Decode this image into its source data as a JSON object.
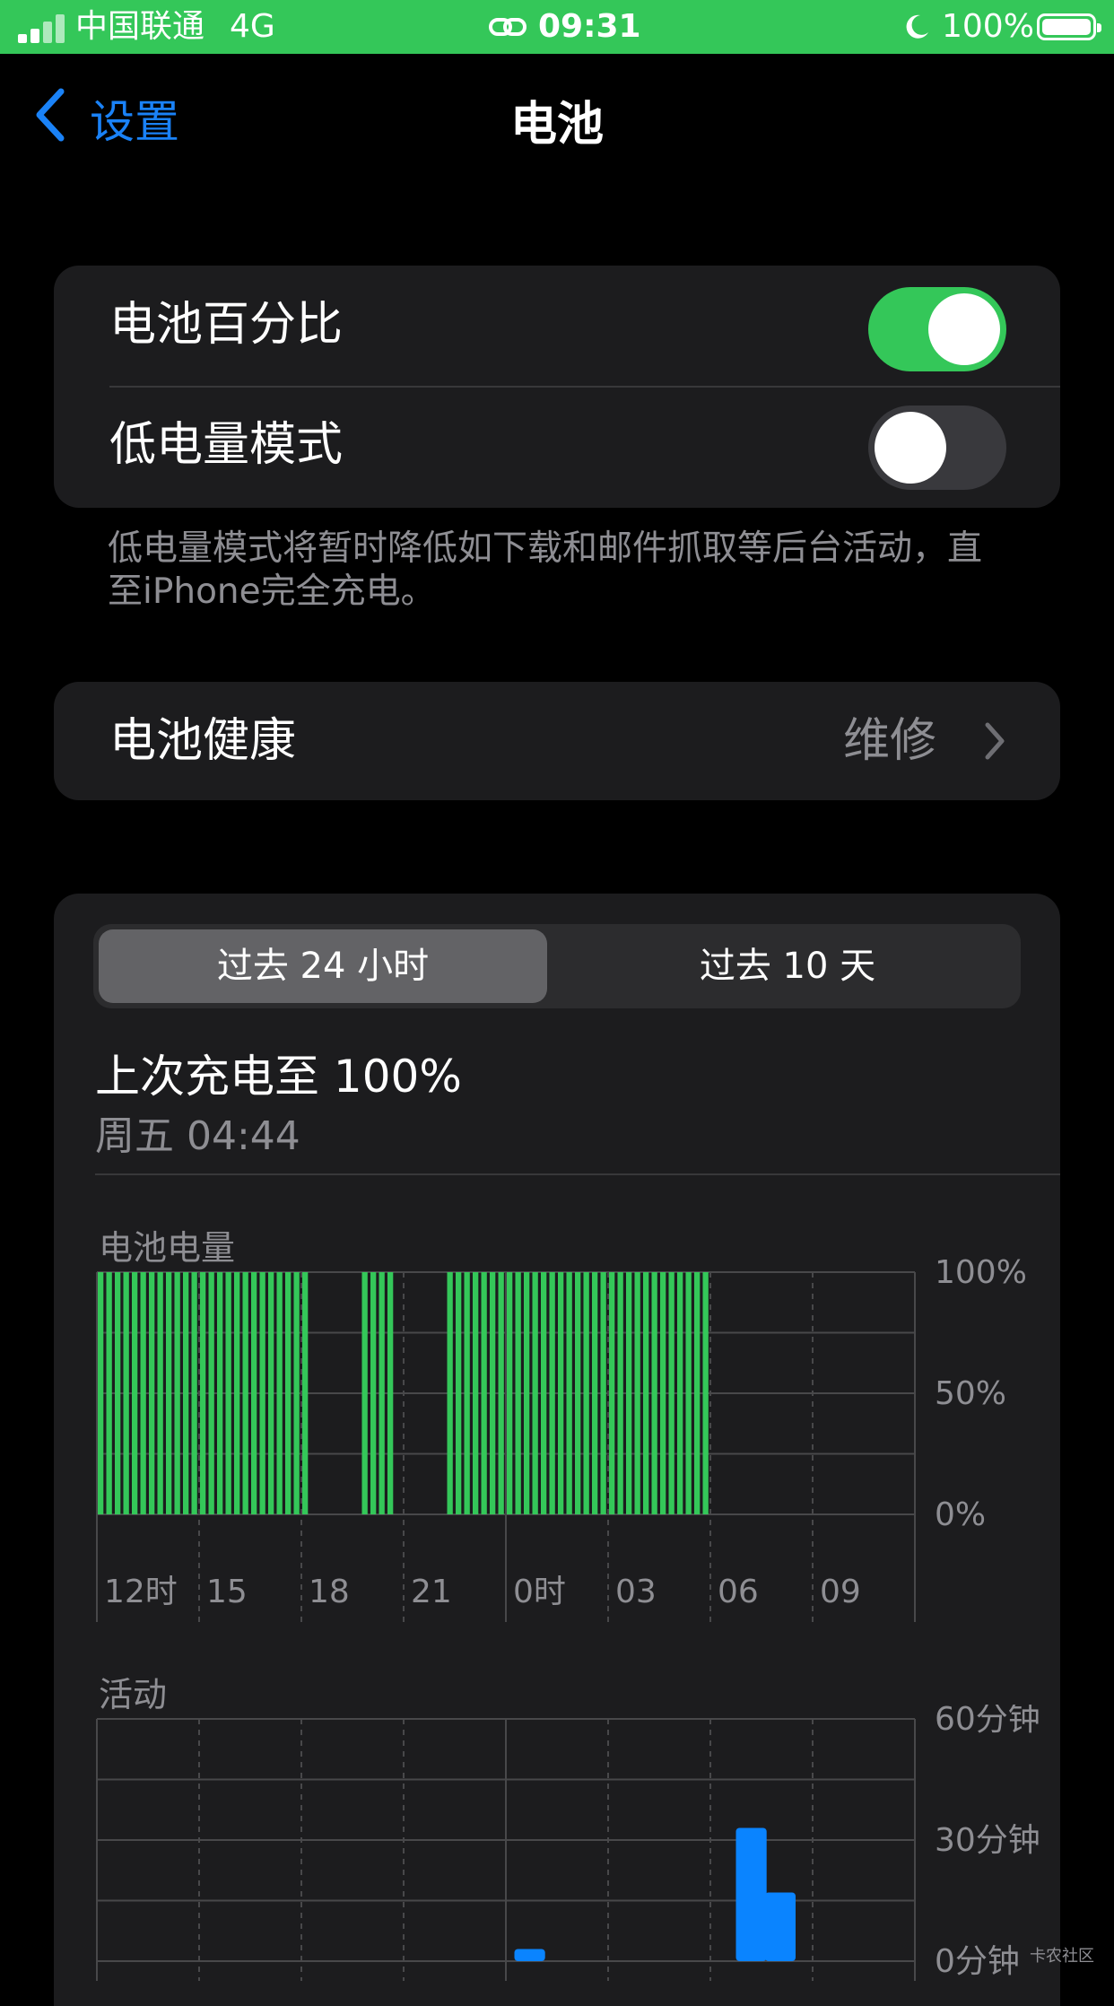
{
  "status_bar": {
    "carrier": "中国联通",
    "network": "4G",
    "time": "09:31",
    "battery_percent": "100%"
  },
  "nav": {
    "back_label": "设置",
    "title": "电池"
  },
  "settings": {
    "battery_percentage": {
      "label": "电池百分比",
      "on": true
    },
    "low_power_mode": {
      "label": "低电量模式",
      "on": false
    },
    "low_power_note": "低电量模式将暂时降低如下载和邮件抓取等后台活动，直至iPhone完全充电。",
    "battery_health": {
      "label": "电池健康",
      "value": "维修"
    }
  },
  "usage": {
    "tabs": [
      {
        "label": "过去 24 小时",
        "active": true
      },
      {
        "label": "过去 10 天",
        "active": false
      }
    ],
    "last_charge_title": "上次充电至 100%",
    "last_charge_time": "周五 04:44"
  },
  "colors": {
    "accent": "#1a82f7",
    "toggle_on": "#34c759",
    "battery_bar": "#34c759",
    "activity_bar": "#0a84ff",
    "card": "#1c1c1e"
  },
  "watermark": "卡农社区",
  "chart_data": [
    {
      "type": "bar",
      "title": "电池电量",
      "x_tick_labels": [
        "12时",
        "15",
        "18",
        "21",
        "0时",
        "03",
        "06",
        "09"
      ],
      "y_tick_labels": [
        "100%",
        "50%",
        "0%"
      ],
      "ylim": [
        0,
        100
      ],
      "bars_per_hour": 4,
      "values": [
        100,
        100,
        100,
        100,
        100,
        100,
        100,
        100,
        100,
        100,
        100,
        100,
        100,
        100,
        100,
        100,
        100,
        100,
        100,
        100,
        100,
        100,
        100,
        100,
        100,
        0,
        0,
        0,
        0,
        0,
        0,
        100,
        100,
        100,
        100,
        0,
        0,
        0,
        0,
        0,
        0,
        100,
        100,
        100,
        100,
        100,
        100,
        100,
        100,
        100,
        100,
        100,
        100,
        100,
        100,
        100,
        100,
        100,
        100,
        100,
        100,
        100,
        100,
        100,
        100,
        100,
        100,
        100,
        100,
        100,
        100,
        100,
        0,
        0,
        0,
        0,
        0,
        0,
        0,
        0,
        0,
        0
      ],
      "grid": true
    },
    {
      "type": "bar",
      "title": "活动",
      "y_tick_labels": [
        "60分钟",
        "30分钟",
        "0分钟"
      ],
      "ylim": [
        0,
        60
      ],
      "points": [
        {
          "hour_index": 12.25,
          "minutes": 3
        },
        {
          "hour_index": 18.75,
          "minutes": 33
        },
        {
          "hour_index": 19.6,
          "minutes": 17
        }
      ],
      "grid": true
    }
  ]
}
